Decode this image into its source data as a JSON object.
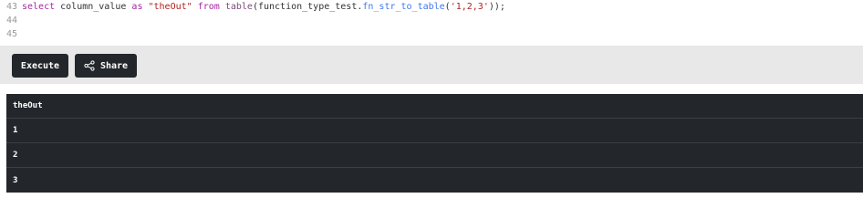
{
  "editor": {
    "lines": [
      {
        "number": "43"
      },
      {
        "number": "44"
      },
      {
        "number": "45"
      }
    ],
    "code": {
      "select": "select",
      "column": " column_value ",
      "as": "as",
      "sp1": " ",
      "alias": "\"theOut\"",
      "sp2": " ",
      "from": "from",
      "sp3": " ",
      "table": "table",
      "paren_open": "(",
      "schema": "function_type_test.",
      "function": "fn_str_to_table",
      "inner_open": "(",
      "arg": "'1,2,3'",
      "close": "));"
    }
  },
  "toolbar": {
    "execute_label": "Execute",
    "share_label": "Share",
    "share_icon": "share-icon"
  },
  "results": {
    "columns": [
      "theOut"
    ],
    "rows": [
      "1",
      "2",
      "3"
    ]
  },
  "colors": {
    "results_bg": "#23272b",
    "toolbar_bg": "#e8e8e8",
    "button_bg": "#23272b"
  }
}
